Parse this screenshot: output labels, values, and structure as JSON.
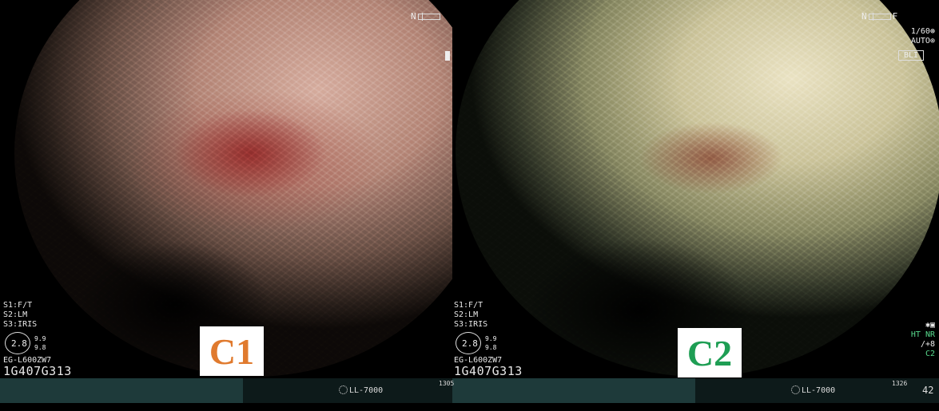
{
  "left": {
    "zoom_indicator": "N",
    "modes": [
      "S1:F/T",
      "S2:LM",
      "S3:IRIS"
    ],
    "gauge": {
      "value": "2.8",
      "side_top": "9.9",
      "side_bottom": "9.8"
    },
    "scope_model": "EG-L600ZW7",
    "serial": "1G407G313",
    "panel_label": "C1",
    "light_source": "LL-7000",
    "frame_count": "1305",
    "label_color": "#e07a2e"
  },
  "right": {
    "zoom_indicator": "N",
    "zoom_end": "F",
    "shutter": "1/60",
    "exposure": "AUTO",
    "mode_box": "BLI",
    "modes": [
      "S1:F/T",
      "S2:LM",
      "S3:IRIS"
    ],
    "gauge": {
      "value": "2.8",
      "side_top": "9.9",
      "side_bottom": "9.8"
    },
    "scope_model": "EG-L600ZW7",
    "serial": "1G407G313",
    "panel_label": "C2",
    "light_source": "LL-7000",
    "frame_count": "1326",
    "page_number": "42",
    "status_lines": [
      "HT NR",
      "/+8",
      "C2"
    ],
    "label_color": "#1e9e54",
    "status_color": "#57d88c"
  }
}
